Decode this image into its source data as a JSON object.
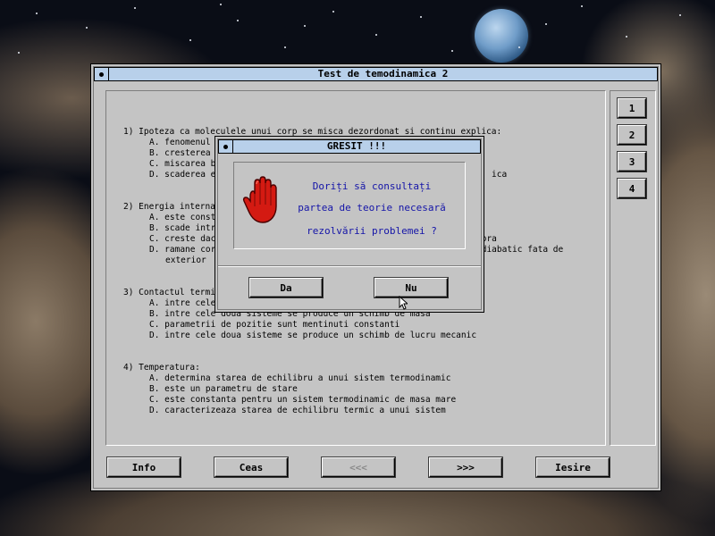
{
  "main_window": {
    "title": "Test de temodinamica 2",
    "questions": [
      {
        "header": "1) Ipoteza ca moleculele unui corp se misca dezordonat si continu explica:",
        "options": [
          "A. fenomenul",
          "B. cresterea",
          "C. miscarea b",
          "D. scaderea e"
        ],
        "tail": "ica"
      },
      {
        "header": "2) Energia interna",
        "options": [
          "A. este const",
          "B. scade intr",
          "C. creste dac",
          "D. ramane cor"
        ],
        "tail_c": "tora",
        "tail_d": "adiabatic fata de",
        "continuation": "exterior"
      },
      {
        "header": "3) Contactul termic",
        "options": [
          "A. intre cele",
          "B. intre cele doua sisteme se produce un schimb de masa",
          "C. parametrii de pozitie sunt mentinuti constanti",
          "D. intre cele doua sisteme se produce un schimb de lucru mecanic"
        ]
      },
      {
        "header": "4) Temperatura:",
        "options": [
          "A. determina starea de echilibru a unui sistem termodinamic",
          "B. este un parametru de stare",
          "C. este constanta pentru un sistem termodinamic de masa mare",
          "D. caracterizeaza starea de echilibru termic a unui sistem"
        ]
      }
    ],
    "side_buttons": [
      "1",
      "2",
      "3",
      "4"
    ],
    "bottom_buttons": {
      "info": "Info",
      "ceas": "Ceas",
      "prev": "<<<",
      "next": ">>>",
      "exit": "Iesire"
    }
  },
  "dialog": {
    "title": "GRESIT !!!",
    "message_lines": [
      "Doriți să consultați",
      "partea de teorie necesară",
      "rezolvării problemei ?"
    ],
    "buttons": {
      "yes": "Da",
      "no": "Nu"
    }
  },
  "icons": {
    "dialog_icon": "stop-hand-icon",
    "hand_color": "#d41a12"
  },
  "colors": {
    "window_face": "#c4c4c4",
    "titlebar": "#b8d0ea",
    "dialog_text": "#1414a8"
  }
}
